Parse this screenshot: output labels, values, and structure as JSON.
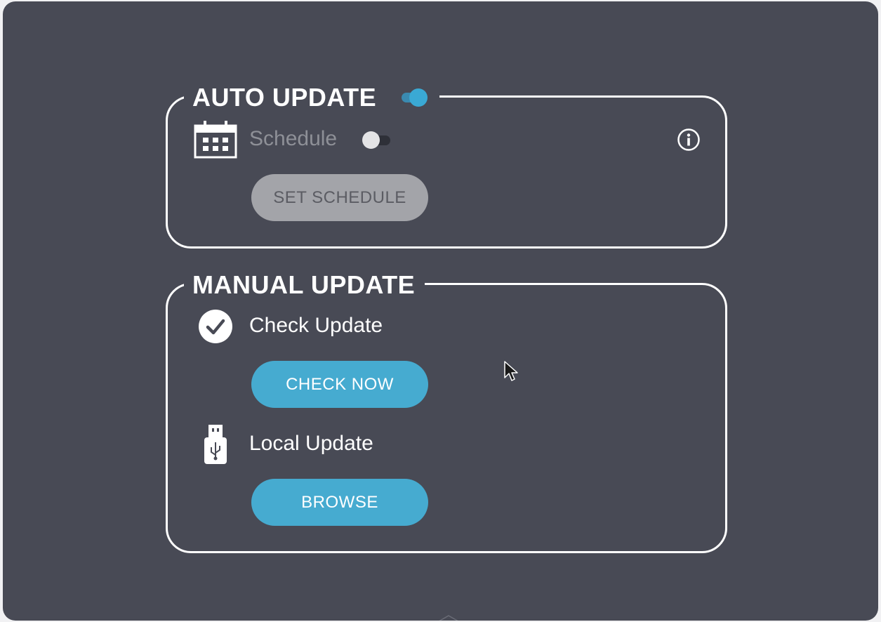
{
  "auto_update": {
    "title": "AUTO UPDATE",
    "enabled": true,
    "schedule": {
      "label": "Schedule",
      "enabled": false,
      "icon": "calendar-icon"
    },
    "set_schedule_button": "SET SCHEDULE",
    "info_icon": "info-icon"
  },
  "manual_update": {
    "title": "MANUAL UPDATE",
    "check_update": {
      "label": "Check Update",
      "icon": "check-circle-icon",
      "button": "CHECK NOW"
    },
    "local_update": {
      "label": "Local Update",
      "icon": "usb-drive-icon",
      "button": "BROWSE"
    }
  },
  "colors": {
    "panel_background": "#484a55",
    "accent": "#46abd0",
    "disabled_button": "#a3a4a9",
    "disabled_text": "#8e9097",
    "border": "#ffffff"
  }
}
